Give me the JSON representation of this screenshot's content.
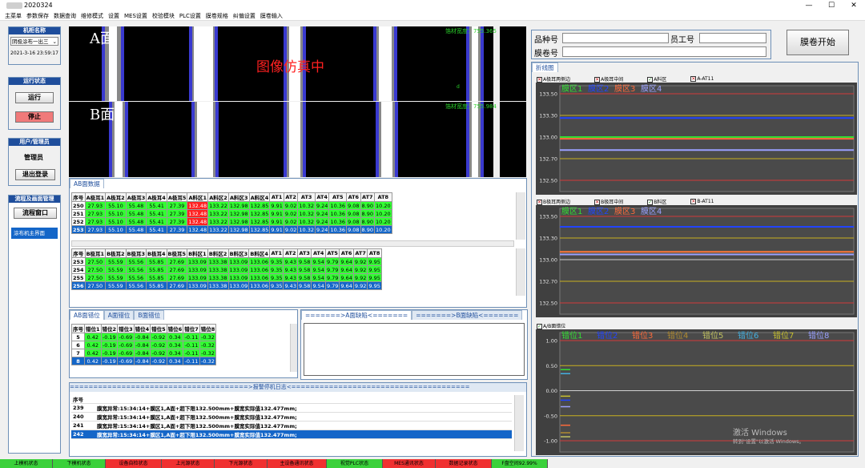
{
  "window": {
    "title": "2020324"
  },
  "menu": [
    "主菜单",
    "参数保存",
    "数据查询",
    "维修模式",
    "设置",
    "MES设置",
    "校验模块",
    "PLC设置",
    "膜卷规格",
    "纠偏设置",
    "膜卷输入"
  ],
  "left": {
    "machine_header": "机柜名称",
    "machine_select": "阴极涂布一出三",
    "datetime": "2021-3-16 23:59:17",
    "run_header": "运行状态",
    "run_btn": "运行",
    "stop_btn": "停止",
    "user_header": "用户/管理员",
    "user_name": "管理员",
    "logout_btn": "退出登录",
    "flow_header": "流程及画面管理",
    "flow_btn": "流程窗口",
    "list_item": "涂布机主界面"
  },
  "camera": {
    "a_label": "A面",
    "b_label": "B面",
    "sim_text": "图像仿真中",
    "a_width_label": "箔材宽度：",
    "a_width_value": "755.365",
    "b_width_label": "箔材宽度：",
    "b_width_value": "755.984",
    "marker": "d"
  },
  "ab_data": {
    "title": "AB面数据",
    "a_headers": [
      "序号",
      "A极耳1",
      "A极耳2",
      "A极耳3",
      "A极耳4",
      "A极耳5",
      "A料区1",
      "A料区2",
      "A料区3",
      "A料区4",
      "AT1",
      "AT2",
      "AT3",
      "AT4",
      "AT5",
      "AT6",
      "AT7",
      "AT8"
    ],
    "a_rows": [
      [
        "250",
        "27.93",
        "55.10",
        "55.48",
        "55.41",
        "27.39",
        "132.48",
        "133.22",
        "132.98",
        "132.85",
        "9.91",
        "9.02",
        "10.32",
        "9.24",
        "10.36",
        "9.08",
        "8.90",
        "10.20"
      ],
      [
        "251",
        "27.93",
        "55.10",
        "55.48",
        "55.41",
        "27.39",
        "132.48",
        "133.22",
        "132.98",
        "132.85",
        "9.91",
        "9.02",
        "10.32",
        "9.24",
        "10.36",
        "9.08",
        "8.90",
        "10.20"
      ],
      [
        "252",
        "27.93",
        "55.10",
        "55.48",
        "55.41",
        "27.39",
        "132.48",
        "133.22",
        "132.98",
        "132.85",
        "9.91",
        "9.02",
        "10.32",
        "9.24",
        "10.36",
        "9.08",
        "8.90",
        "10.20"
      ],
      [
        "253",
        "27.93",
        "55.10",
        "55.48",
        "55.41",
        "27.39",
        "132.48",
        "133.22",
        "132.98",
        "132.85",
        "9.91",
        "9.02",
        "10.32",
        "9.24",
        "10.36",
        "9.08",
        "8.90",
        "10.20"
      ]
    ],
    "b_headers": [
      "序号",
      "B极耳1",
      "B极耳2",
      "B极耳3",
      "B极耳4",
      "B极耳5",
      "B料区1",
      "B料区2",
      "B料区3",
      "B料区4",
      "AT1",
      "AT2",
      "AT3",
      "AT4",
      "AT5",
      "AT6",
      "AT7",
      "AT8"
    ],
    "b_rows": [
      [
        "253",
        "27.50",
        "55.59",
        "55.56",
        "55.85",
        "27.69",
        "133.09",
        "133.38",
        "133.09",
        "133.06",
        "9.35",
        "9.43",
        "9.58",
        "9.54",
        "9.79",
        "9.64",
        "9.92",
        "9.95"
      ],
      [
        "254",
        "27.50",
        "55.59",
        "55.56",
        "55.85",
        "27.69",
        "133.09",
        "133.38",
        "133.09",
        "133.06",
        "9.35",
        "9.43",
        "9.58",
        "9.54",
        "9.79",
        "9.64",
        "9.92",
        "9.95"
      ],
      [
        "255",
        "27.50",
        "55.59",
        "55.56",
        "55.85",
        "27.69",
        "133.09",
        "133.38",
        "133.09",
        "133.06",
        "9.35",
        "9.43",
        "9.58",
        "9.54",
        "9.79",
        "9.64",
        "9.92",
        "9.95"
      ],
      [
        "256",
        "27.50",
        "55.59",
        "55.56",
        "55.85",
        "27.69",
        "133.09",
        "133.38",
        "133.09",
        "133.06",
        "9.35",
        "9.43",
        "9.58",
        "9.54",
        "9.79",
        "9.64",
        "9.92",
        "9.95"
      ]
    ]
  },
  "offset": {
    "tabs": [
      "AB面错位",
      "A面错位",
      "B面错位"
    ],
    "headers": [
      "序号",
      "错位1",
      "错位2",
      "错位3",
      "错位4",
      "错位5",
      "错位6",
      "错位7",
      "错位8"
    ],
    "rows": [
      [
        "5",
        "0.42",
        "-0.19",
        "-0.69",
        "-0.84",
        "-0.92",
        "0.34",
        "-0.11",
        "-0.32"
      ],
      [
        "6",
        "0.42",
        "-0.19",
        "-0.69",
        "-0.84",
        "-0.92",
        "0.34",
        "-0.11",
        "-0.32"
      ],
      [
        "7",
        "0.42",
        "-0.19",
        "-0.69",
        "-0.84",
        "-0.92",
        "0.34",
        "-0.11",
        "-0.32"
      ],
      [
        "8",
        "0.42",
        "-0.19",
        "-0.69",
        "-0.84",
        "-0.92",
        "0.34",
        "-0.11",
        "-0.32"
      ]
    ]
  },
  "defect": {
    "a_tab": "=======>A面缺陷<=======",
    "b_tab": "=======>B面缺陷<======="
  },
  "alarm": {
    "title": "======================================>报警停机日志<======================================",
    "header": "序号",
    "rows": [
      [
        "239",
        "膜宽异常:15:34:14+膜区1,A面+超下限132.500mm+膜宽实际值132.477mm;"
      ],
      [
        "240",
        "膜宽异常:15:34:14+膜区1,A面+超下限132.500mm+膜宽实际值132.477mm;"
      ],
      [
        "241",
        "膜宽异常:15:34:14+膜区1,A面+超下限132.500mm+膜宽实际值132.477mm;"
      ],
      [
        "242",
        "膜宽异常:15:34:14+膜区1,A面+超下限132.500mm+膜宽实际值132.477mm;"
      ]
    ]
  },
  "info": {
    "product_label": "品种号",
    "employee_label": "员工号",
    "roll_label": "膜卷号",
    "start_btn": "膜卷开始"
  },
  "charts": {
    "title": "折线图",
    "a_checks": [
      "A极耳两侧边",
      "A极耳中间",
      "A料区",
      "A-AT11"
    ],
    "b_checks": [
      "B极耳两侧边",
      "B极耳中间",
      "B料区",
      "B-AT11"
    ],
    "c_check": "A/B面错位",
    "zone_labels": [
      "膜区1",
      "膜区2",
      "膜区3",
      "膜区4"
    ],
    "zone_colors": [
      "#33dd33",
      "#2244ff",
      "#ff6a3a",
      "#9aa0ff"
    ],
    "ab_ticks": [
      "133.50",
      "133.30",
      "133.00",
      "132.70",
      "132.50"
    ],
    "offset_labels": [
      "错位1",
      "错位2",
      "错位3",
      "错位4",
      "错位5",
      "错位6",
      "错位7",
      "错位8"
    ],
    "offset_colors": [
      "#33dd33",
      "#2244ff",
      "#ff6a3a",
      "#b08a30",
      "#c0c060",
      "#44b0e0",
      "#c8c030",
      "#9aa0ff"
    ],
    "offset_ticks": [
      "1.00",
      "0.50",
      "0.00",
      "-0.50",
      "-1.00"
    ],
    "a_values": [
      133.0,
      133.22,
      132.98,
      132.85
    ],
    "b_values": [
      133.09,
      133.38,
      133.09,
      133.06
    ]
  },
  "watermark": {
    "line1": "激活 Windows",
    "line2": "转到\"设置\"以激活 Windows。"
  },
  "status": [
    {
      "label": "上模机状态",
      "c": "g"
    },
    {
      "label": "下模机状态",
      "c": "g"
    },
    {
      "label": "设备自检状态",
      "c": "r"
    },
    {
      "label": "上光源状态",
      "c": "r"
    },
    {
      "label": "下光源状态",
      "c": "r"
    },
    {
      "label": "主设备通讯状态",
      "c": "r"
    },
    {
      "label": "视觉PLC状态",
      "c": "g"
    },
    {
      "label": "MES通讯状态",
      "c": "r"
    },
    {
      "label": "数据记录状态",
      "c": "r"
    },
    {
      "label": "F盘空间92.99%",
      "c": "g"
    }
  ]
}
